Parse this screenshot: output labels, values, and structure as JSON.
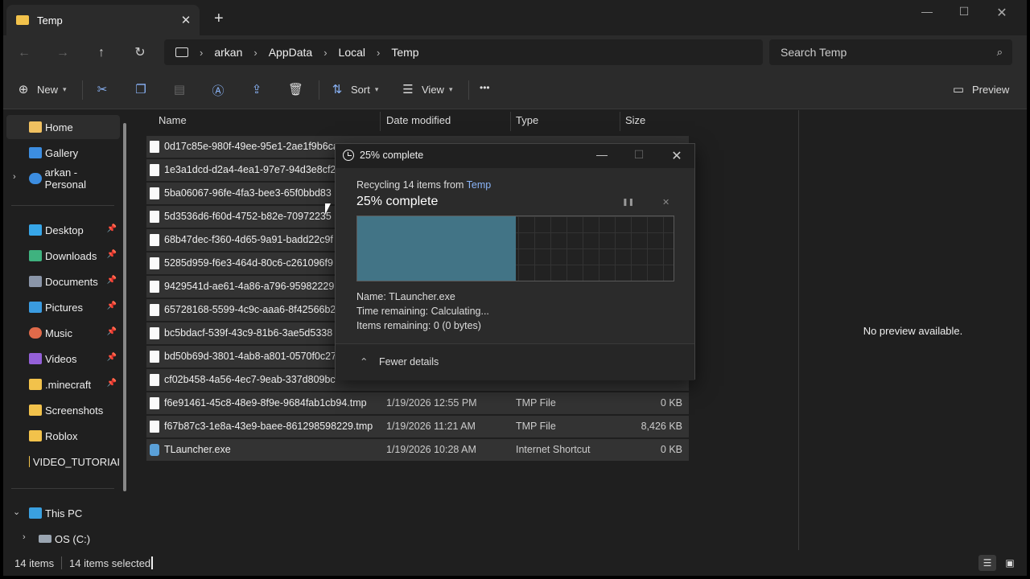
{
  "tab": {
    "title": "Temp",
    "close": "✕",
    "new_tab": "+"
  },
  "window": {
    "minimize": "—",
    "maximize": "☐",
    "close": "✕"
  },
  "nav": {
    "back": "←",
    "forward": "→",
    "up": "↑",
    "refresh": "↻"
  },
  "breadcrumbs": [
    "arkan",
    "AppData",
    "Local",
    "Temp"
  ],
  "search": {
    "placeholder": "Search Temp"
  },
  "toolbar": {
    "new_label": "New",
    "sort_label": "Sort",
    "view_label": "View",
    "more": "•••",
    "preview_label": "Preview"
  },
  "sidebar": {
    "items": [
      {
        "label": "Home",
        "icon": "home-icon",
        "color": "#f0c060"
      },
      {
        "label": "Gallery",
        "icon": "gallery-icon",
        "color": "#3c8de0"
      },
      {
        "label": "arkan - Personal",
        "icon": "onedrive-icon",
        "color": "#3c8de0"
      },
      {
        "label": "Desktop",
        "icon": "desktop-icon",
        "color": "#37a6e8"
      },
      {
        "label": "Downloads",
        "icon": "downloads-icon",
        "color": "#3fb27f"
      },
      {
        "label": "Documents",
        "icon": "documents-icon",
        "color": "#8a95a8"
      },
      {
        "label": "Pictures",
        "icon": "pictures-icon",
        "color": "#3a9be0"
      },
      {
        "label": "Music",
        "icon": "music-icon",
        "color": "#e06a4a"
      },
      {
        "label": "Videos",
        "icon": "videos-icon",
        "color": "#9460d8"
      },
      {
        "label": ".minecraft",
        "icon": "folder-icon",
        "color": "#f2c24b"
      },
      {
        "label": "Screenshots",
        "icon": "folder-icon",
        "color": "#f2c24b"
      },
      {
        "label": "Roblox",
        "icon": "folder-icon",
        "color": "#f2c24b"
      },
      {
        "label": "VIDEO_TUTORIAI",
        "icon": "folder-icon",
        "color": "#f2c24b"
      },
      {
        "label": "This PC",
        "icon": "pc-icon",
        "color": "#3aa0e0"
      },
      {
        "label": "OS (C:)",
        "icon": "drive-icon",
        "color": "#9aa5b1"
      }
    ]
  },
  "columns": {
    "name": "Name",
    "date": "Date modified",
    "type": "Type",
    "size": "Size"
  },
  "files": [
    {
      "name": "0d17c85e-980f-49ee-95e1-2ae1f9b6ca",
      "date": "",
      "type": "",
      "size": ""
    },
    {
      "name": "1e3a1dcd-d2a4-4ea1-97e7-94d3e8cf2",
      "date": "",
      "type": "",
      "size": ""
    },
    {
      "name": "5ba06067-96fe-4fa3-bee3-65f0bbd83",
      "date": "",
      "type": "",
      "size": ""
    },
    {
      "name": "5d3536d6-f60d-4752-b82e-70972235",
      "date": "",
      "type": "",
      "size": ""
    },
    {
      "name": "68b47dec-f360-4d65-9a91-badd22c9f",
      "date": "",
      "type": "",
      "size": ""
    },
    {
      "name": "5285d959-f6e3-464d-80c6-c261096f9",
      "date": "",
      "type": "",
      "size": ""
    },
    {
      "name": "9429541d-ae61-4a86-a796-95982229",
      "date": "",
      "type": "",
      "size": ""
    },
    {
      "name": "65728168-5599-4c9c-aaa6-8f42566b2",
      "date": "",
      "type": "",
      "size": ""
    },
    {
      "name": "bc5bdacf-539f-43c9-81b6-3ae5d5338",
      "date": "",
      "type": "",
      "size": ""
    },
    {
      "name": "bd50b69d-3801-4ab8-a801-0570f0c27",
      "date": "",
      "type": "",
      "size": ""
    },
    {
      "name": "cf02b458-4a56-4ec7-9eab-337d809bc",
      "date": "",
      "type": "",
      "size": ""
    },
    {
      "name": "f6e91461-45c8-48e9-8f9e-9684fab1cb94.tmp",
      "date": "1/19/2026 12:55 PM",
      "type": "TMP File",
      "size": "0 KB"
    },
    {
      "name": "f67b87c3-1e8a-43e9-baee-861298598229.tmp",
      "date": "1/19/2026 11:21 AM",
      "type": "TMP File",
      "size": "8,426 KB"
    },
    {
      "name": "TLauncher.exe",
      "date": "1/19/2026 10:28 AM",
      "type": "Internet Shortcut",
      "size": "0 KB"
    }
  ],
  "preview": {
    "text": "No preview available."
  },
  "status": {
    "count": "14 items",
    "selected": "14 items selected"
  },
  "dialog": {
    "title": "25% complete",
    "recycling_prefix": "Recycling 14 items from",
    "recycling_source": "Temp",
    "heading": "25% complete",
    "progress": 0.25,
    "pause": "❚❚",
    "cancel": "✕",
    "name_label": "Name:",
    "name_value": "TLauncher.exe",
    "time_label": "Time remaining:",
    "time_value": "Calculating...",
    "items_label": "Items remaining:",
    "items_value": "0 (0 bytes)",
    "fewer_details": "Fewer details",
    "minimize": "—",
    "maximize": "☐",
    "close": "✕",
    "accent": "#427486"
  }
}
